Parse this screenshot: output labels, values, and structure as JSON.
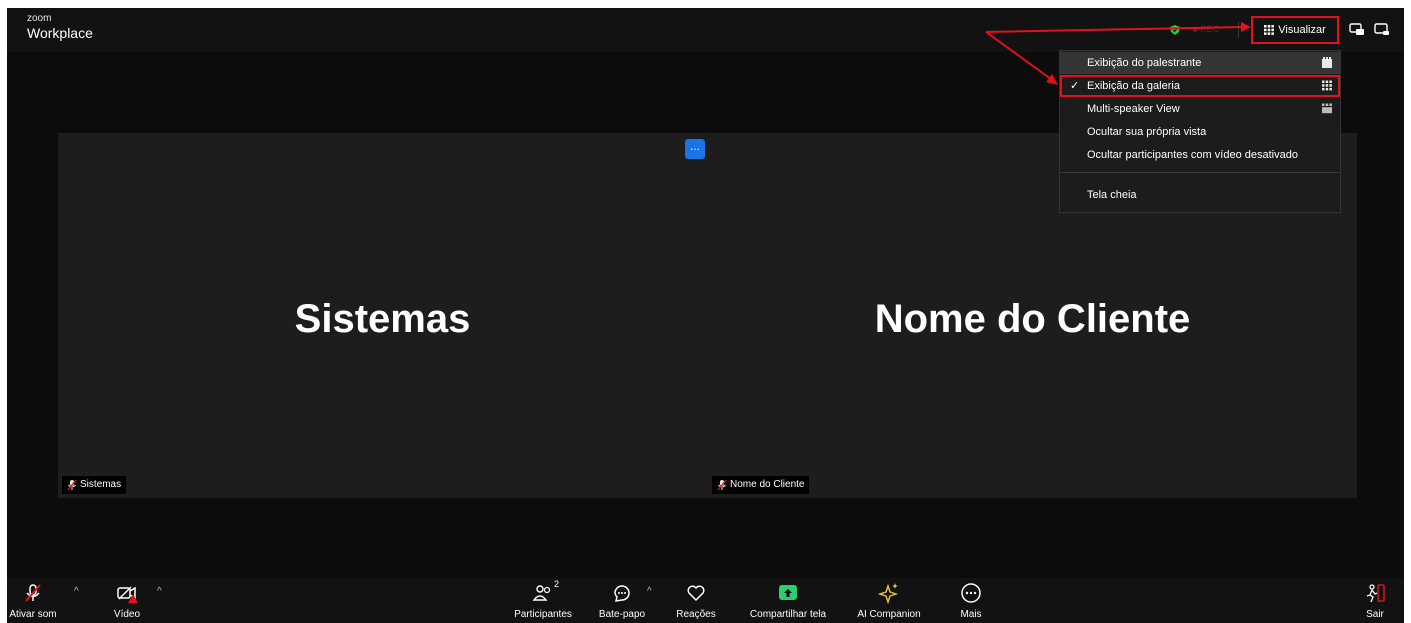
{
  "app": {
    "logo_small": "zoom",
    "logo_big": "Workplace",
    "rec_label": "REC"
  },
  "header": {
    "view_button_label": "Visualizar",
    "icons": [
      "shield-icon",
      "grid-icon",
      "speaker-layout-icon",
      "minimize-icon"
    ]
  },
  "view_menu": {
    "items": [
      {
        "label": "Exibição do palestrante",
        "icon": "speaker-view-icon",
        "checked": false
      },
      {
        "label": "Exibição da galeria",
        "icon": "gallery-grid-icon",
        "checked": true,
        "check_mark": "✓"
      },
      {
        "label": "Multi-speaker View",
        "icon": "multi-speaker-icon",
        "checked": false
      },
      {
        "label": "Ocultar sua própria vista",
        "checked": false
      },
      {
        "label": "Ocultar participantes com vídeo desativado",
        "checked": false
      }
    ],
    "fullscreen_label": "Tela cheia"
  },
  "participants": [
    {
      "display_name": "Sistemas",
      "label": "Sistemas",
      "muted": true
    },
    {
      "display_name": "Nome do Cliente",
      "label": "Nome do Cliente",
      "muted": true
    }
  ],
  "tile_menu_badge": "...",
  "toolbar": {
    "audio_label": "Ativar som",
    "video_label": "Vídeo",
    "participants_label": "Participantes",
    "participants_count": "2",
    "chat_label": "Bate-papo",
    "reactions_label": "Reações",
    "share_label": "Compartilhar tela",
    "ai_label": "AI Companion",
    "more_label": "Mais",
    "leave_label": "Sair"
  },
  "colors": {
    "accent_share": "#2ecc71",
    "annotation_red": "#e0121b",
    "badge_blue": "#1a73e8",
    "ai_gold": "#f5c542"
  }
}
